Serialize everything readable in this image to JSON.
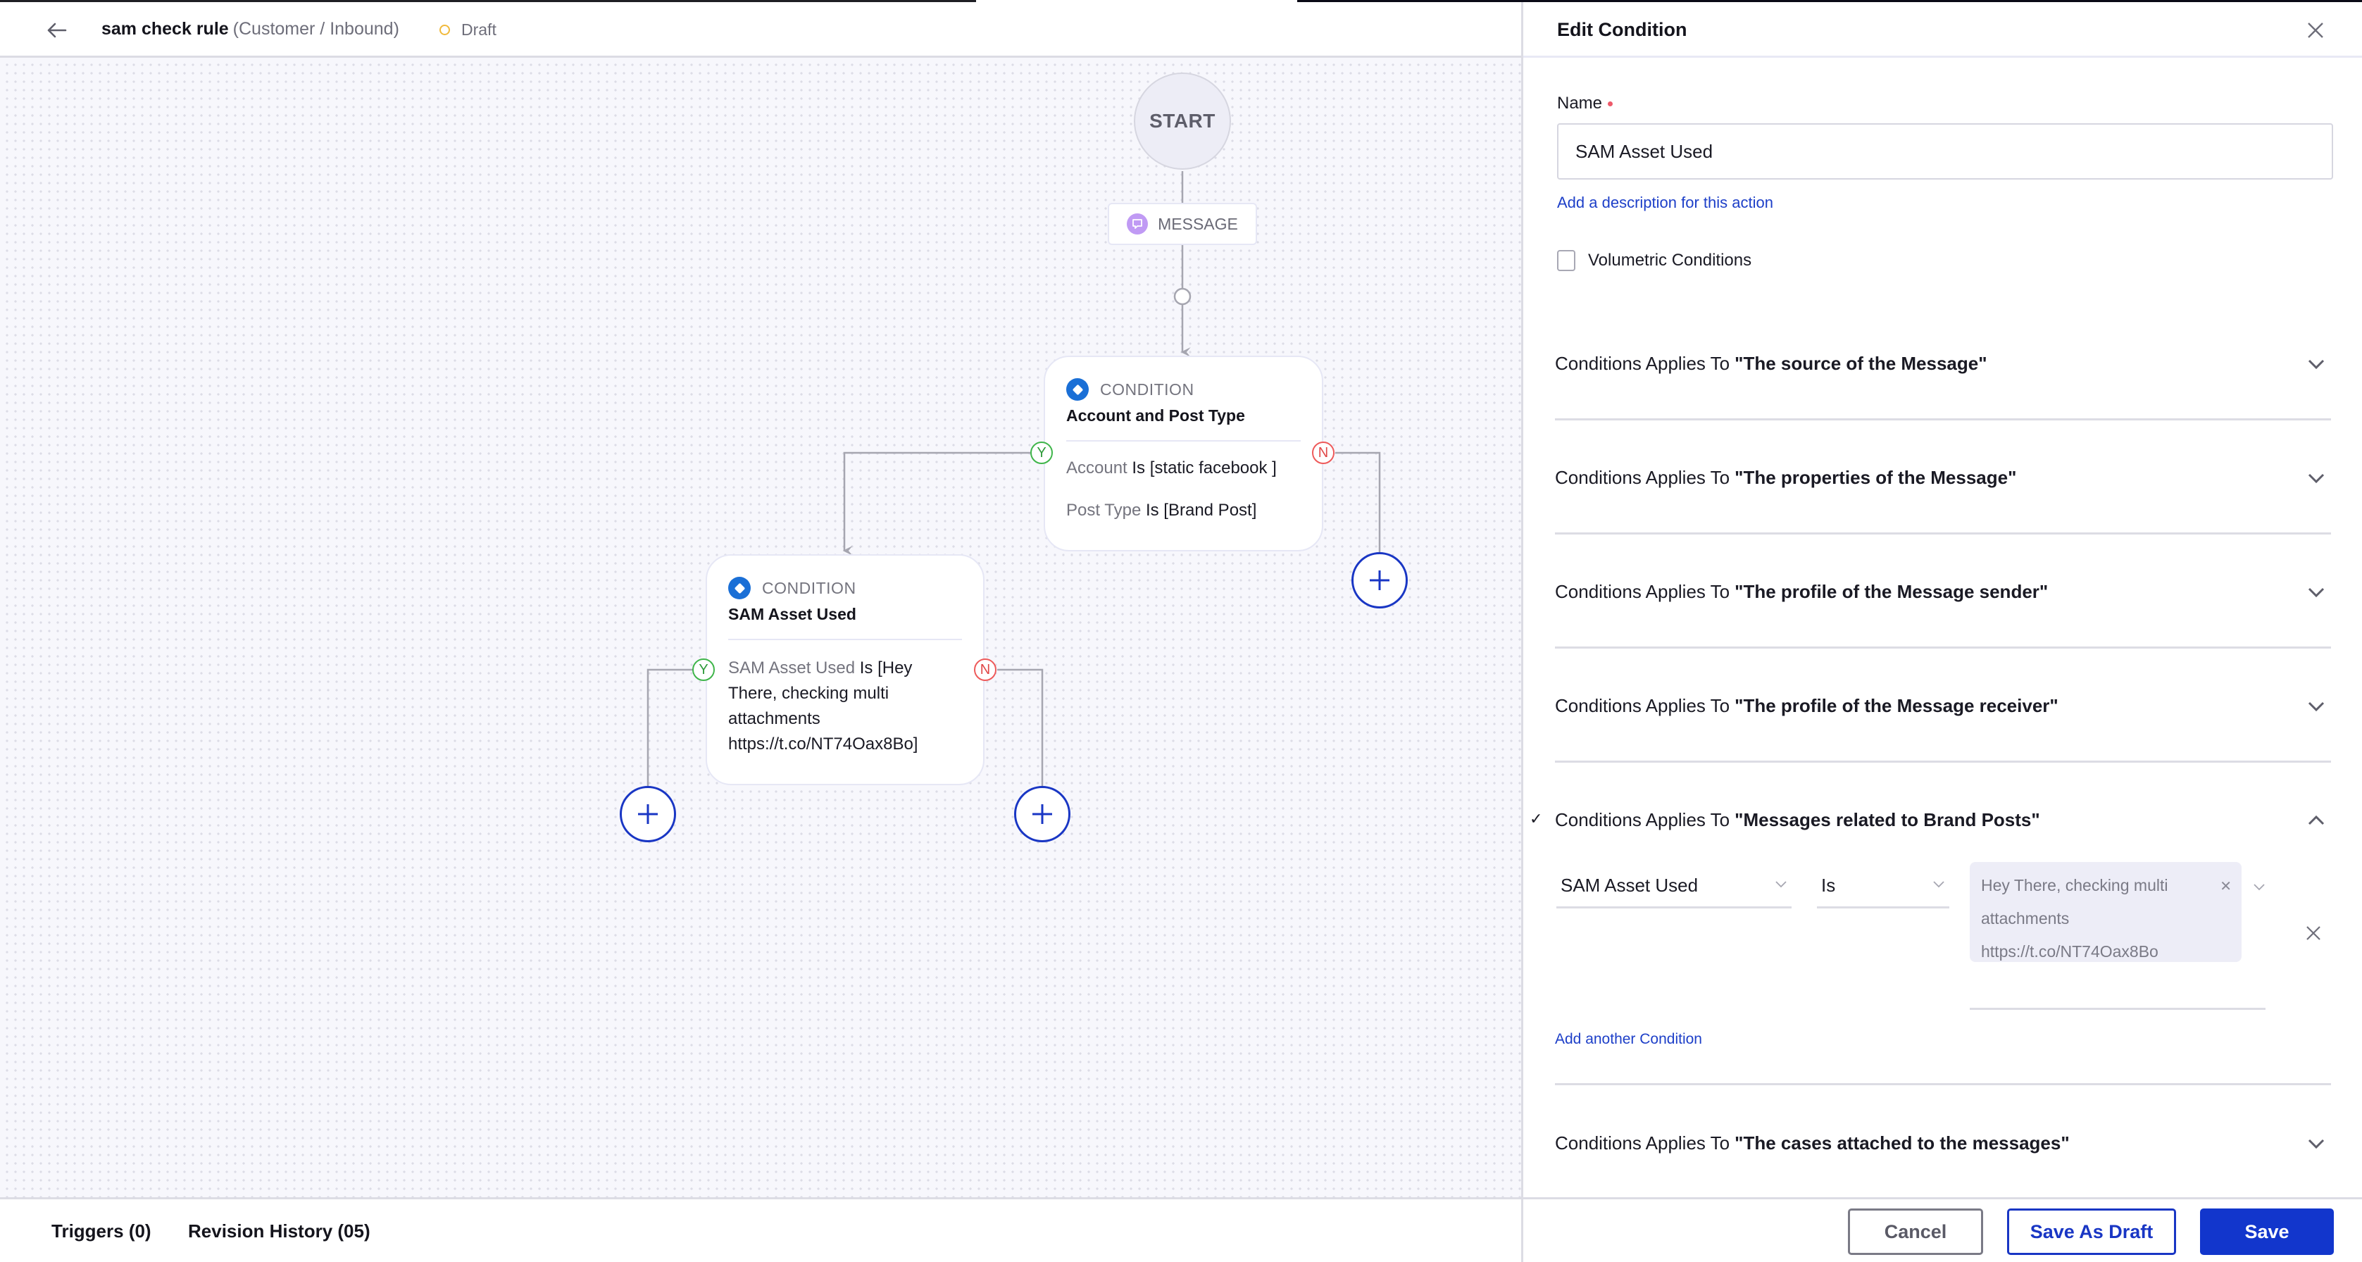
{
  "header": {
    "back_icon": "arrow-left-icon",
    "rule_name": "sam check rule",
    "rule_context": "(Customer / Inbound)",
    "status": "Draft",
    "status_color": "#f1b93a"
  },
  "canvas": {
    "start_label": "START",
    "message_node": {
      "icon": "message-icon",
      "label": "MESSAGE",
      "icon_color": "#c09af4"
    },
    "conditions": [
      {
        "type_label": "CONDITION",
        "name": "Account and Post Type",
        "rules": [
          {
            "key": "Account",
            "value": "Is [static facebook ]"
          },
          {
            "key": "Post Type",
            "value": "Is [Brand Post]"
          }
        ],
        "yes_label": "Y",
        "no_label": "N"
      },
      {
        "type_label": "CONDITION",
        "name": "SAM Asset Used",
        "rules": [
          {
            "key": "SAM Asset Used",
            "value": "Is [Hey There, checking multi attachments https://t.co/NT74Oax8Bo]"
          }
        ],
        "yes_label": "Y",
        "no_label": "N"
      }
    ],
    "add_node_icon": "plus-icon"
  },
  "footer": {
    "tabs": [
      {
        "label": "Triggers (0)"
      },
      {
        "label": "Revision History (05)"
      }
    ]
  },
  "panel": {
    "title": "Edit Condition",
    "close_icon": "close-icon",
    "name_label": "Name",
    "name_value": "SAM Asset Used",
    "description_link": "Add a description for this action",
    "volumetric_label": "Volumetric Conditions",
    "volumetric_checked": false,
    "section_prefix": "Conditions Applies To",
    "sections": [
      {
        "title": "\"The source of the Message\"",
        "expanded": false
      },
      {
        "title": "\"The properties of the Message\"",
        "expanded": false
      },
      {
        "title": "\"The profile of the Message sender\"",
        "expanded": false
      },
      {
        "title": "\"The profile of the Message receiver\"",
        "expanded": false
      },
      {
        "title": "\"Messages related to Brand Posts\"",
        "expanded": true,
        "applied": true
      },
      {
        "title": "\"The cases attached to the messages\"",
        "expanded": false
      }
    ],
    "condition_row": {
      "field": "SAM Asset Used",
      "operator": "Is",
      "values": [
        "Hey There, checking multi attachments https://t.co/NT74Oax8Bo"
      ],
      "chip_lines": [
        "Hey There, checking multi",
        "attachments",
        "https://t.co/NT74Oax8Bo"
      ]
    },
    "add_condition_link": "Add another Condition",
    "buttons": {
      "cancel": "Cancel",
      "save_draft": "Save As Draft",
      "save": "Save"
    },
    "accent_color": "#1236cc"
  }
}
